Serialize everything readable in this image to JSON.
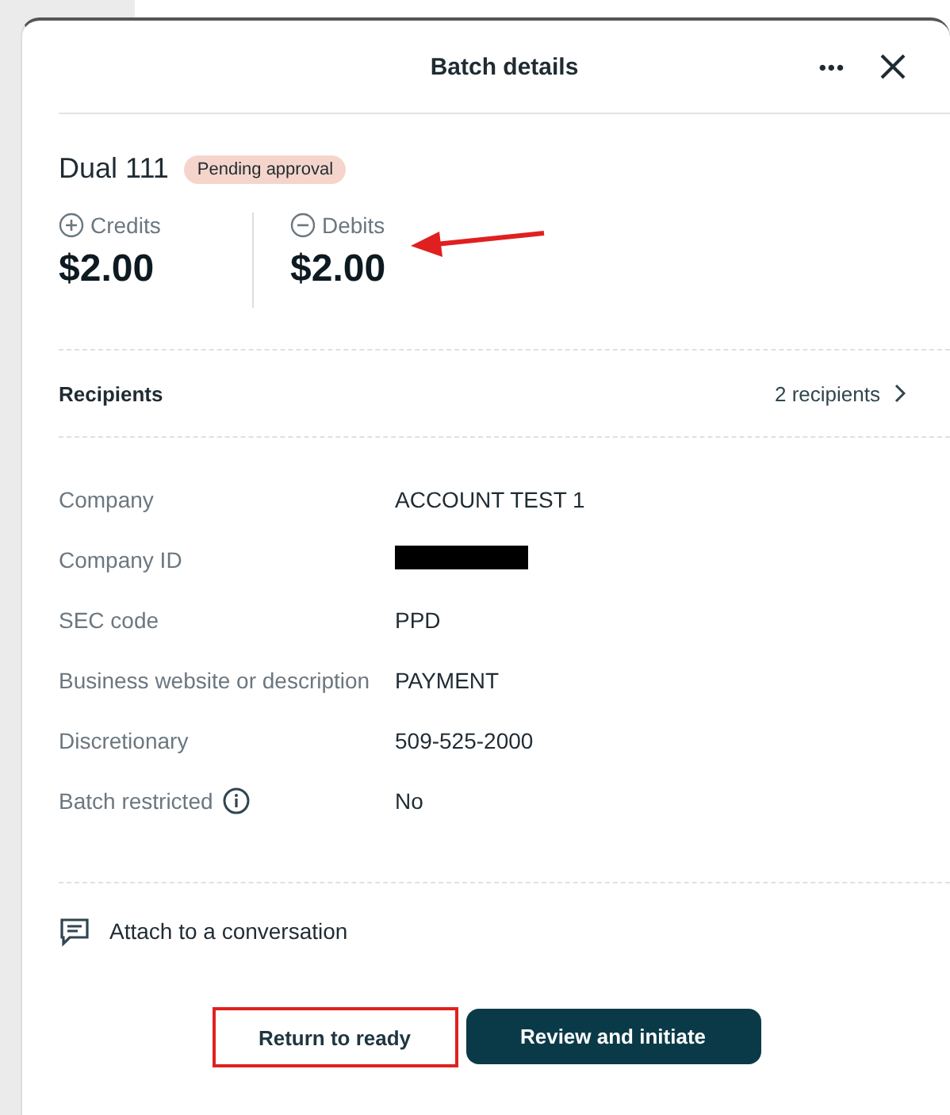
{
  "dialog": {
    "title": "Batch details",
    "more_icon": "•••"
  },
  "batch": {
    "name": "Dual 111",
    "status": "Pending approval"
  },
  "totals": [
    {
      "kind": "credit",
      "label": "Credits",
      "amount": "$2.00",
      "annotated": false
    },
    {
      "kind": "debit",
      "label": "Debits",
      "amount": "$2.00",
      "annotated": true
    }
  ],
  "recipients": {
    "label": "Recipients",
    "count": "2 recipients"
  },
  "details": [
    {
      "kind": "text",
      "label": "Company",
      "value": "ACCOUNT TEST 1"
    },
    {
      "kind": "redacted",
      "label": "Company ID"
    },
    {
      "kind": "text",
      "label": "SEC code",
      "value": "PPD"
    },
    {
      "kind": "text",
      "label": "Business website or description",
      "value": "PAYMENT"
    },
    {
      "kind": "text",
      "label": "Discretionary",
      "value": "509-525-2000"
    },
    {
      "kind": "info",
      "label": "Batch restricted",
      "value": "No"
    }
  ],
  "attach": {
    "label": "Attach to a conversation"
  },
  "buttons": [
    {
      "kind": "secondary",
      "label": "Return to ready",
      "highlighted": true
    },
    {
      "kind": "primary",
      "label": "Review and initiate",
      "highlighted": false
    }
  ]
}
